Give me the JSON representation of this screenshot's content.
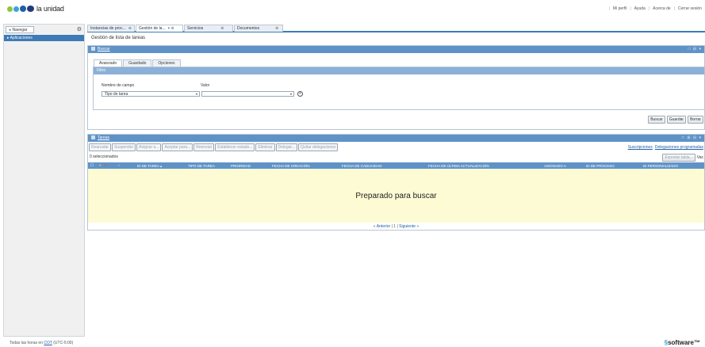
{
  "header": {
    "brand": "la unidad",
    "links": [
      "Mi perfil",
      "Ayuda",
      "Acerca de",
      "Cerrar sesión"
    ]
  },
  "leftnav": {
    "tab_label": "Navegar",
    "applications": "Aplicaciones"
  },
  "tabs": [
    {
      "label": "Instancias de proc..."
    },
    {
      "label": "Gestión de la..."
    },
    {
      "label": "Servicios"
    },
    {
      "label": "Documentos"
    }
  ],
  "page_title": "Gestión de lista de tareas",
  "search": {
    "title": "Buscar",
    "subtabs": [
      "Avanzado",
      "Guardado",
      "Opciones"
    ],
    "filter_title": "Filtro",
    "field_name_label": "Nombre de campo",
    "value_label": "Valor",
    "field_value": "Tipo de tarea",
    "value_value": "",
    "buttons": [
      "Buscar",
      "Guardar",
      "Borrar"
    ]
  },
  "tasks": {
    "title": "Tareas",
    "actions": [
      "Reanudar",
      "Suspender",
      "Asignar a...",
      "Aceptar para...",
      "Reenviar",
      "Establecer estado...",
      "Eliminar",
      "Delegar...",
      "Quitar delegaciones"
    ],
    "links": [
      "Suscripciones",
      "Delegaciones programadas"
    ],
    "selected_count": "0 seleccionados",
    "export_button": "Exportar tabla...",
    "export_link": "Vac",
    "columns": [
      "ID DE TAREA ▴",
      "TIPO DE TAREA",
      "PRIORIDAD",
      "FECHA DE CREACIÓN",
      "FECHA DE CADUCIDAD",
      "FECHA DE ÚLTIMA ACTUALIZACIÓN",
      "ASIGNADO A",
      "ID DE PROCESO",
      "ID PERSONALIZADO"
    ],
    "empty_message": "Preparado para buscar",
    "pager": {
      "prev": "« Anterior",
      "page": "1",
      "next": "Siguiente »"
    }
  },
  "footer": {
    "timezone_prefix": "Todas las horas en",
    "timezone_code": "COT",
    "timezone_suffix": "(UTC-5:00)",
    "vendor": "software"
  }
}
